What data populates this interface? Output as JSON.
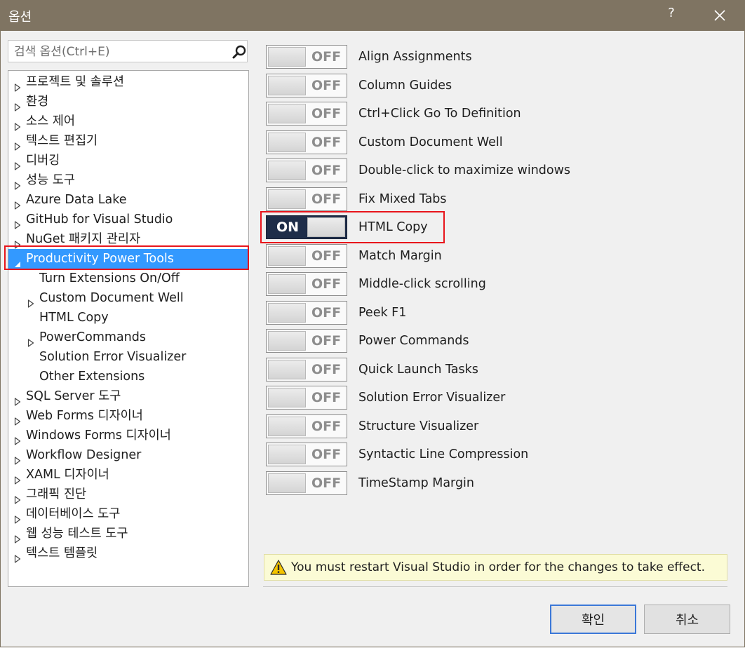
{
  "window": {
    "title": "옵션",
    "help_label": "?"
  },
  "search": {
    "placeholder": "검색 옵션(Ctrl+E)",
    "value": ""
  },
  "tree": [
    {
      "label": "프로젝트 및 솔루션",
      "level": 0,
      "expander": "collapsed"
    },
    {
      "label": "환경",
      "level": 0,
      "expander": "collapsed"
    },
    {
      "label": "소스 제어",
      "level": 0,
      "expander": "collapsed"
    },
    {
      "label": "텍스트 편집기",
      "level": 0,
      "expander": "collapsed"
    },
    {
      "label": "디버깅",
      "level": 0,
      "expander": "collapsed"
    },
    {
      "label": "성능 도구",
      "level": 0,
      "expander": "collapsed"
    },
    {
      "label": "Azure Data Lake",
      "level": 0,
      "expander": "collapsed"
    },
    {
      "label": "GitHub for Visual Studio",
      "level": 0,
      "expander": "collapsed"
    },
    {
      "label": "NuGet 패키지 관리자",
      "level": 0,
      "expander": "collapsed"
    },
    {
      "label": "Productivity Power Tools",
      "level": 0,
      "expander": "expanded",
      "selected": true
    },
    {
      "label": "Turn Extensions On/Off",
      "level": 1,
      "expander": "none"
    },
    {
      "label": "Custom Document Well",
      "level": 1,
      "expander": "collapsed"
    },
    {
      "label": "HTML Copy",
      "level": 1,
      "expander": "none"
    },
    {
      "label": "PowerCommands",
      "level": 1,
      "expander": "collapsed"
    },
    {
      "label": "Solution Error Visualizer",
      "level": 1,
      "expander": "none"
    },
    {
      "label": "Other Extensions",
      "level": 1,
      "expander": "none"
    },
    {
      "label": "SQL Server 도구",
      "level": 0,
      "expander": "collapsed"
    },
    {
      "label": "Web Forms 디자이너",
      "level": 0,
      "expander": "collapsed"
    },
    {
      "label": "Windows Forms 디자이너",
      "level": 0,
      "expander": "collapsed"
    },
    {
      "label": "Workflow Designer",
      "level": 0,
      "expander": "collapsed"
    },
    {
      "label": "XAML 디자이너",
      "level": 0,
      "expander": "collapsed"
    },
    {
      "label": "그래픽 진단",
      "level": 0,
      "expander": "collapsed"
    },
    {
      "label": "데이터베이스 도구",
      "level": 0,
      "expander": "collapsed"
    },
    {
      "label": "웹 성능 테스트 도구",
      "level": 0,
      "expander": "collapsed"
    },
    {
      "label": "텍스트 템플릿",
      "level": 0,
      "expander": "collapsed"
    }
  ],
  "extensions": [
    {
      "label": "Align Assignments",
      "state": "OFF"
    },
    {
      "label": "Column Guides",
      "state": "OFF"
    },
    {
      "label": "Ctrl+Click Go To Definition",
      "state": "OFF"
    },
    {
      "label": "Custom Document Well",
      "state": "OFF"
    },
    {
      "label": "Double-click to maximize windows",
      "state": "OFF"
    },
    {
      "label": "Fix Mixed Tabs",
      "state": "OFF"
    },
    {
      "label": "HTML Copy",
      "state": "ON"
    },
    {
      "label": "Match Margin",
      "state": "OFF"
    },
    {
      "label": "Middle-click scrolling",
      "state": "OFF"
    },
    {
      "label": "Peek F1",
      "state": "OFF"
    },
    {
      "label": "Power Commands",
      "state": "OFF"
    },
    {
      "label": "Quick Launch Tasks",
      "state": "OFF"
    },
    {
      "label": "Solution Error Visualizer",
      "state": "OFF"
    },
    {
      "label": "Structure Visualizer",
      "state": "OFF"
    },
    {
      "label": "Syntactic Line Compression",
      "state": "OFF"
    },
    {
      "label": "TimeStamp Margin",
      "state": "OFF"
    }
  ],
  "warning": {
    "text": "You must restart Visual Studio in order for the changes to take effect."
  },
  "buttons": {
    "ok": "확인",
    "cancel": "취소"
  },
  "colors": {
    "titlebar": "#7f7462",
    "selection": "#3399ff",
    "toggle_on": "#1e2d49",
    "highlight_box": "#e8141b",
    "warning_bg": "#fbfbd5"
  }
}
